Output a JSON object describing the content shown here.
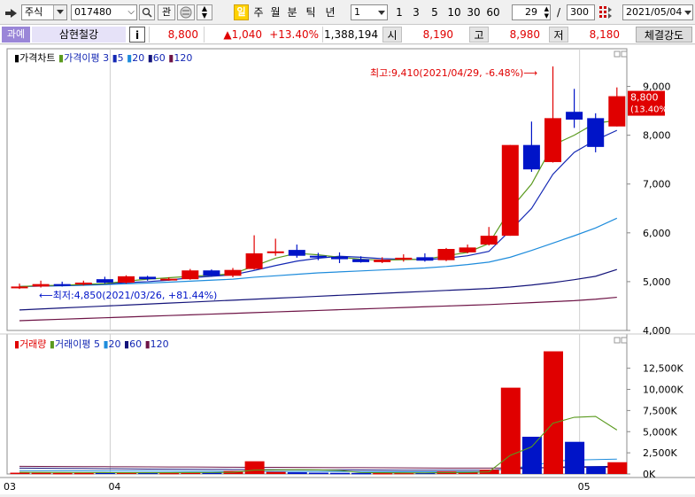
{
  "toolbar": {
    "market_select": "주식",
    "stock_code": "017480",
    "related_button": "관",
    "period_active": "일",
    "periods_rest": [
      "주",
      "월",
      "분",
      "틱",
      "년"
    ],
    "interval_value": "1",
    "intervals": [
      "1",
      "3",
      "5",
      "10",
      "30",
      "60"
    ],
    "visible_count": "29",
    "total_count": "300",
    "date": "2021/05/04"
  },
  "quote": {
    "tax_badge": "과예",
    "stock_name": "삼현철강",
    "info_button": "i",
    "price": "8,800",
    "change": "▲1,040",
    "change_pct": "+13.40%",
    "volume": "1,388,194",
    "open_label": "시",
    "open": "8,190",
    "high_label": "고",
    "high": "8,980",
    "low_label": "저",
    "low": "8,180",
    "strength_button": "체결강도"
  },
  "colors": {
    "up": "#e00000",
    "down": "#0014c8",
    "ma3": "#5a9a1e",
    "ma5": "#1428b4",
    "ma20": "#1e8cdc",
    "ma60": "#14147a",
    "ma120": "#6e1446"
  },
  "chart_data": [
    {
      "type": "candlestick",
      "legend": [
        "가격차트",
        "가격이평 3",
        "5",
        "20",
        "60",
        "120"
      ],
      "ylim": [
        4000,
        9700
      ],
      "yticks": [
        "9,000",
        "8,000",
        "7,000",
        "6,000",
        "5,000",
        "4,000"
      ],
      "ytick_values": [
        9000,
        8000,
        7000,
        6000,
        5000,
        4000
      ],
      "xticks": [
        "03",
        "04",
        "05"
      ],
      "current_label": "8,800",
      "current_pct_label": "(13.40%)",
      "annot_high": "최고:9,410(2021/04/29, -6.48%)⟶",
      "annot_low": "⟵최저:4,850(2021/03/26, +81.44%)",
      "candles": [
        {
          "o": 4900,
          "h": 4960,
          "l": 4850,
          "c": 4900
        },
        {
          "o": 4900,
          "h": 5020,
          "l": 4880,
          "c": 4950
        },
        {
          "o": 4950,
          "h": 5000,
          "l": 4900,
          "c": 4920
        },
        {
          "o": 4950,
          "h": 5020,
          "l": 4920,
          "c": 4980
        },
        {
          "o": 5050,
          "h": 5100,
          "l": 4960,
          "c": 4980
        },
        {
          "o": 4980,
          "h": 5130,
          "l": 4960,
          "c": 5110
        },
        {
          "o": 5100,
          "h": 5120,
          "l": 5020,
          "c": 5050
        },
        {
          "o": 5050,
          "h": 5090,
          "l": 5020,
          "c": 5060
        },
        {
          "o": 5050,
          "h": 5260,
          "l": 5040,
          "c": 5230
        },
        {
          "o": 5230,
          "h": 5250,
          "l": 5100,
          "c": 5120
        },
        {
          "o": 5120,
          "h": 5280,
          "l": 5090,
          "c": 5240
        },
        {
          "o": 5260,
          "h": 5950,
          "l": 5250,
          "c": 5580
        },
        {
          "o": 5600,
          "h": 5880,
          "l": 5530,
          "c": 5620
        },
        {
          "o": 5650,
          "h": 5760,
          "l": 5490,
          "c": 5530
        },
        {
          "o": 5530,
          "h": 5590,
          "l": 5440,
          "c": 5510
        },
        {
          "o": 5510,
          "h": 5600,
          "l": 5380,
          "c": 5460
        },
        {
          "o": 5460,
          "h": 5520,
          "l": 5390,
          "c": 5400
        },
        {
          "o": 5400,
          "h": 5500,
          "l": 5380,
          "c": 5450
        },
        {
          "o": 5450,
          "h": 5560,
          "l": 5410,
          "c": 5490
        },
        {
          "o": 5500,
          "h": 5580,
          "l": 5410,
          "c": 5430
        },
        {
          "o": 5440,
          "h": 5690,
          "l": 5420,
          "c": 5670
        },
        {
          "o": 5600,
          "h": 5760,
          "l": 5580,
          "c": 5700
        },
        {
          "o": 5760,
          "h": 6120,
          "l": 5740,
          "c": 5940
        },
        {
          "o": 5940,
          "h": 7800,
          "l": 5940,
          "c": 7800
        },
        {
          "o": 7800,
          "h": 8280,
          "l": 7250,
          "c": 7300
        },
        {
          "o": 7450,
          "h": 9410,
          "l": 7440,
          "c": 8350
        },
        {
          "o": 8480,
          "h": 8950,
          "l": 8150,
          "c": 8320
        },
        {
          "o": 8350,
          "h": 8450,
          "l": 7650,
          "c": 7760
        },
        {
          "o": 8180,
          "h": 8980,
          "l": 8180,
          "c": 8800
        }
      ],
      "ma3": [
        4900,
        4920,
        4925,
        4945,
        4960,
        5010,
        5050,
        5080,
        5110,
        5130,
        5160,
        5320,
        5480,
        5580,
        5550,
        5500,
        5460,
        5440,
        5450,
        5460,
        5530,
        5600,
        5780,
        6480,
        7000,
        7800,
        8000,
        8250,
        8300
      ],
      "ma5": [
        4900,
        4910,
        4920,
        4935,
        4950,
        4980,
        5000,
        5030,
        5080,
        5110,
        5140,
        5230,
        5330,
        5420,
        5480,
        5520,
        5500,
        5470,
        5460,
        5450,
        5480,
        5530,
        5620,
        6050,
        6500,
        7200,
        7650,
        7900,
        8100
      ],
      "ma20": [
        4900,
        4910,
        4915,
        4925,
        4940,
        4955,
        4970,
        4990,
        5010,
        5030,
        5050,
        5090,
        5120,
        5150,
        5180,
        5200,
        5220,
        5240,
        5260,
        5280,
        5310,
        5350,
        5400,
        5500,
        5640,
        5790,
        5940,
        6100,
        6300
      ],
      "ma60": [
        4420,
        4440,
        4460,
        4480,
        4500,
        4520,
        4540,
        4560,
        4580,
        4600,
        4620,
        4640,
        4660,
        4680,
        4700,
        4720,
        4740,
        4760,
        4780,
        4800,
        4820,
        4840,
        4860,
        4890,
        4930,
        4980,
        5040,
        5110,
        5250
      ],
      "ma120": [
        4200,
        4215,
        4230,
        4245,
        4260,
        4275,
        4290,
        4305,
        4320,
        4335,
        4350,
        4365,
        4380,
        4395,
        4410,
        4425,
        4440,
        4455,
        4470,
        4485,
        4500,
        4515,
        4530,
        4550,
        4570,
        4590,
        4610,
        4640,
        4680
      ]
    },
    {
      "type": "bar",
      "legend": [
        "거래량",
        "거래이평 5",
        "20",
        "60",
        "120"
      ],
      "ylim": [
        0,
        15500
      ],
      "yticks": [
        "12,500K",
        "10,000K",
        "7,500K",
        "5,000K",
        "2,500K",
        "0K"
      ],
      "ytick_values": [
        12500,
        10000,
        7500,
        5000,
        2500,
        0
      ],
      "volumes": [
        150,
        140,
        120,
        130,
        160,
        200,
        150,
        130,
        180,
        170,
        350,
        1500,
        250,
        200,
        150,
        130,
        120,
        110,
        130,
        150,
        300,
        220,
        500,
        10200,
        4400,
        14500,
        3800,
        900,
        1388
      ],
      "up": [
        1,
        1,
        1,
        1,
        0,
        1,
        0,
        1,
        1,
        0,
        1,
        1,
        1,
        0,
        0,
        0,
        0,
        1,
        1,
        0,
        1,
        1,
        1,
        1,
        0,
        1,
        0,
        0,
        1
      ],
      "ma5": [
        200,
        190,
        180,
        170,
        160,
        150,
        150,
        150,
        160,
        170,
        200,
        450,
        480,
        500,
        480,
        420,
        170,
        150,
        140,
        130,
        160,
        180,
        250,
        2200,
        3200,
        6000,
        6700,
        6800,
        5200
      ],
      "ma20": [
        400,
        390,
        380,
        370,
        360,
        350,
        340,
        330,
        320,
        310,
        300,
        300,
        300,
        300,
        300,
        290,
        280,
        270,
        260,
        260,
        260,
        260,
        280,
        720,
        900,
        1500,
        1650,
        1700,
        1750
      ],
      "ma60": [
        700,
        680,
        660,
        640,
        620,
        600,
        580,
        560,
        550,
        540,
        530,
        520,
        510,
        500,
        490,
        480,
        470,
        460,
        450,
        440,
        440,
        440,
        450,
        600,
        650,
        800,
        850,
        880,
        900
      ],
      "ma120": [
        900,
        890,
        880,
        870,
        860,
        850,
        840,
        830,
        820,
        810,
        800,
        790,
        780,
        770,
        760,
        750,
        740,
        730,
        720,
        710,
        700,
        690,
        690,
        720,
        730,
        760,
        770,
        780,
        790
      ]
    }
  ]
}
